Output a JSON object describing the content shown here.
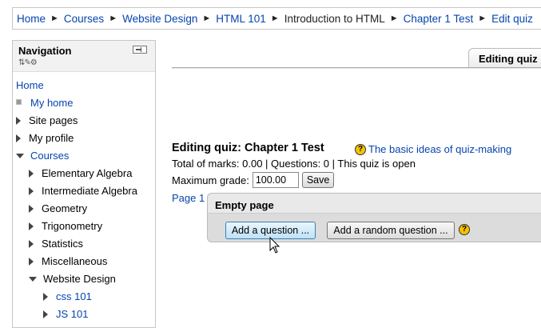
{
  "breadcrumb": {
    "items": [
      {
        "label": "Home",
        "link": true
      },
      {
        "label": "Courses",
        "link": true
      },
      {
        "label": "Website Design",
        "link": true
      },
      {
        "label": "HTML 101",
        "link": true
      },
      {
        "label": "Introduction to HTML",
        "link": false
      },
      {
        "label": "Chapter 1 Test",
        "link": true
      },
      {
        "label": "Edit quiz",
        "link": true
      }
    ],
    "separator": "►"
  },
  "navigation": {
    "title": "Navigation",
    "items": [
      {
        "label": "Home",
        "indent": 0,
        "marker": "none",
        "link": true
      },
      {
        "label": "My home",
        "indent": 0,
        "marker": "square",
        "link": true
      },
      {
        "label": "Site pages",
        "indent": 0,
        "marker": "collapsed",
        "link": false
      },
      {
        "label": "My profile",
        "indent": 0,
        "marker": "collapsed",
        "link": false
      },
      {
        "label": "Courses",
        "indent": 0,
        "marker": "expanded",
        "link": true
      },
      {
        "label": "Elementary Algebra",
        "indent": 1,
        "marker": "collapsed",
        "link": false
      },
      {
        "label": "Intermediate Algebra",
        "indent": 1,
        "marker": "collapsed",
        "link": false
      },
      {
        "label": "Geometry",
        "indent": 1,
        "marker": "collapsed",
        "link": false
      },
      {
        "label": "Trigonometry",
        "indent": 1,
        "marker": "collapsed",
        "link": false
      },
      {
        "label": "Statistics",
        "indent": 1,
        "marker": "collapsed",
        "link": false
      },
      {
        "label": "Miscellaneous",
        "indent": 1,
        "marker": "collapsed",
        "link": false
      },
      {
        "label": "Website Design",
        "indent": 1,
        "marker": "expanded",
        "link": false
      },
      {
        "label": "css 101",
        "indent": 2,
        "marker": "collapsed",
        "link": true
      },
      {
        "label": "JS 101",
        "indent": 2,
        "marker": "collapsed",
        "link": true
      }
    ]
  },
  "tab": {
    "label": "Editing quiz"
  },
  "quiz": {
    "title": "Editing quiz: Chapter 1 Test",
    "help_link": "The basic ideas of quiz-making",
    "summary": "Total of marks: 0.00 | Questions: 0 | This quiz is open",
    "max_grade_label": "Maximum grade:",
    "max_grade_value": "100.00",
    "save_label": "Save",
    "page_label": "Page 1",
    "page_title": "Empty page",
    "add_question_label": "Add a question ...",
    "add_random_label": "Add a random question ..."
  },
  "icons": {
    "help": "help-icon",
    "dock": "dock-block-icon",
    "move": "move-icon",
    "cursor": "mouse-pointer-icon"
  },
  "colors": {
    "link": "#0645ad",
    "accent_button": "#bfe2f7",
    "help_icon": "#f6c200"
  }
}
